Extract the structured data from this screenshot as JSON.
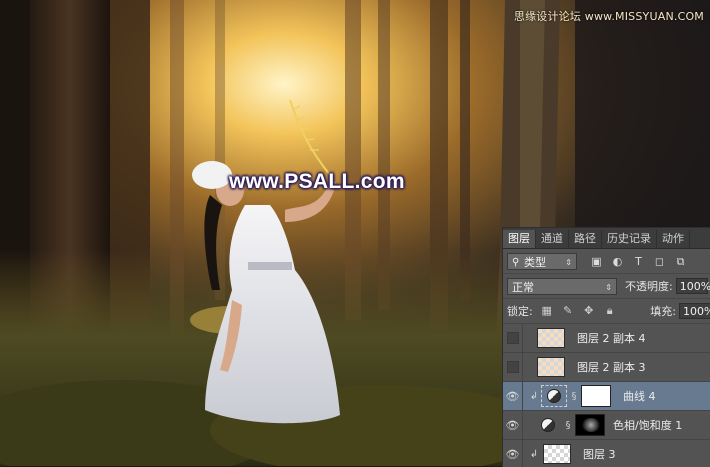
{
  "watermark": {
    "top": "思缘设计论坛 www.MISSYUAN.COM",
    "center": "www.PSALL.com"
  },
  "panel": {
    "tabs": [
      "图层",
      "通道",
      "路径",
      "历史记录",
      "动作"
    ],
    "active_tab": "图层",
    "filter": {
      "label": "类型"
    },
    "blend_mode": {
      "value": "正常",
      "opacity_label": "不透明度:",
      "opacity_value": "100%"
    },
    "lock": {
      "label": "锁定:",
      "fill_label": "填充:",
      "fill_value": "100%"
    },
    "layers": [
      {
        "name": "图层 2 副本 4",
        "visible": false,
        "kind": "pixel",
        "selected": false
      },
      {
        "name": "图层 2 副本 3",
        "visible": false,
        "kind": "pixel",
        "selected": false
      },
      {
        "name": "曲线 4",
        "visible": true,
        "kind": "adjustment",
        "selected": true
      },
      {
        "name": "色相/饱和度 1",
        "visible": true,
        "kind": "adjustment",
        "selected": false
      },
      {
        "name": "图层 3",
        "visible": true,
        "kind": "pixel",
        "selected": false
      }
    ]
  },
  "colors": {
    "panel_bg": "#535353",
    "tab_bar_bg": "#3c3c3c",
    "selected_layer": "#677a8f",
    "watermark_outline": "#2b1d5a"
  }
}
